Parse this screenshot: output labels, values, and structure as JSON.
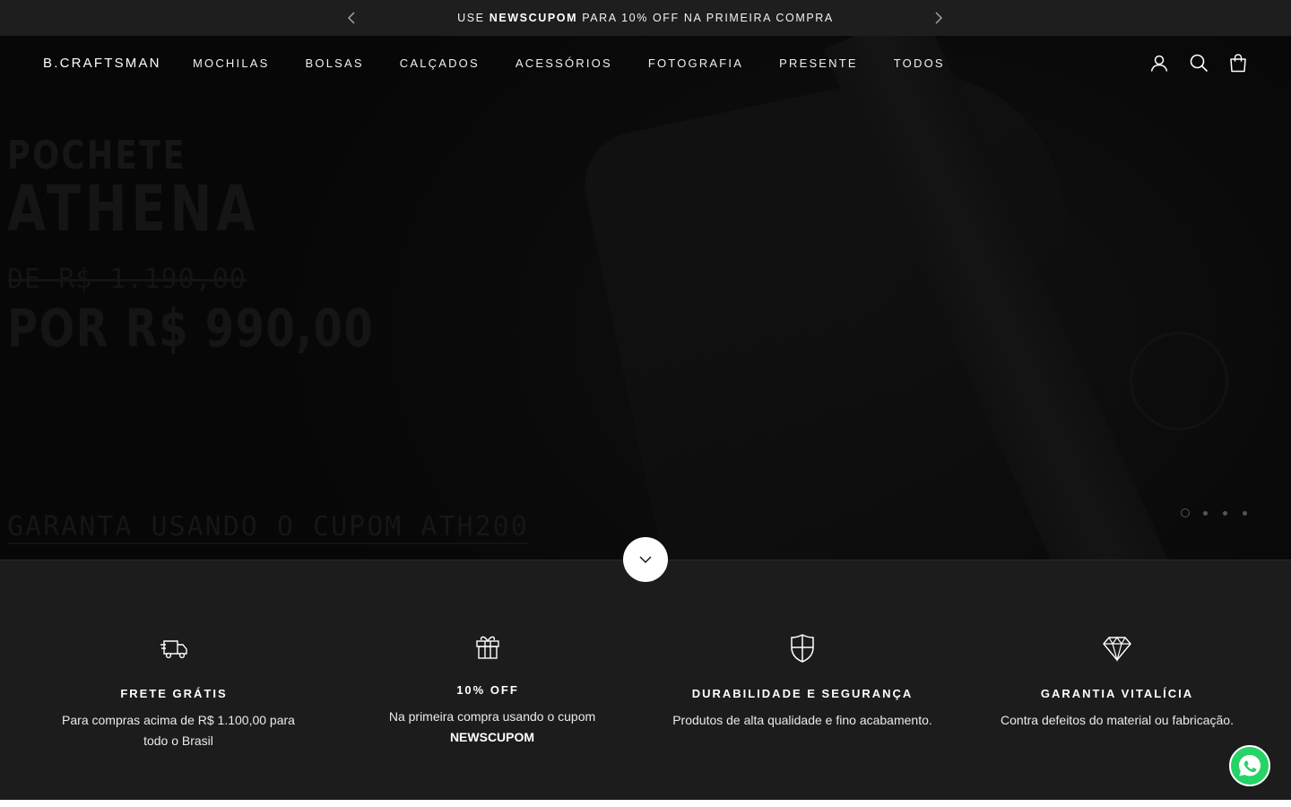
{
  "announcement": {
    "prefix": "USE ",
    "code": "NEWSCUPOM",
    "suffix": " PARA 10% OFF NA PRIMEIRA COMPRA"
  },
  "header": {
    "logo": "B.CRAFTSMAN",
    "nav": [
      "MOCHILAS",
      "BOLSAS",
      "CALÇADOS",
      "ACESSÓRIOS",
      "FOTOGRAFIA",
      "PRESENTE",
      "TODOS"
    ],
    "icons": [
      "account-icon",
      "search-icon",
      "cart-icon"
    ]
  },
  "hero": {
    "line1": "POCHETE",
    "line2": "ATHENA",
    "old_price": "DE R$ 1.190,00",
    "price": "POR R$ 990,00",
    "cupom": "GARANTA USANDO O CUPOM ATH200",
    "slide_count": 4,
    "active_slide": 1
  },
  "features": [
    {
      "icon": "truck-icon",
      "title": "FRETE GRÁTIS",
      "desc": "Para compras acima de R$ 1.100,00 para todo o Brasil"
    },
    {
      "icon": "gift-icon",
      "title": "10% OFF",
      "desc": "Na primeira compra usando o cupom",
      "desc_bold": "NEWSCUPOM"
    },
    {
      "icon": "shield-icon",
      "title": "DURABILIDADE E SEGURANÇA",
      "desc": "Produtos de alta qualidade e fino acabamento."
    },
    {
      "icon": "diamond-icon",
      "title": "GARANTIA VITALÍCIA",
      "desc": "Contra defeitos do material ou fabricação."
    }
  ],
  "colors": {
    "background": "#1c1c1c",
    "whatsapp": "#25d366"
  }
}
